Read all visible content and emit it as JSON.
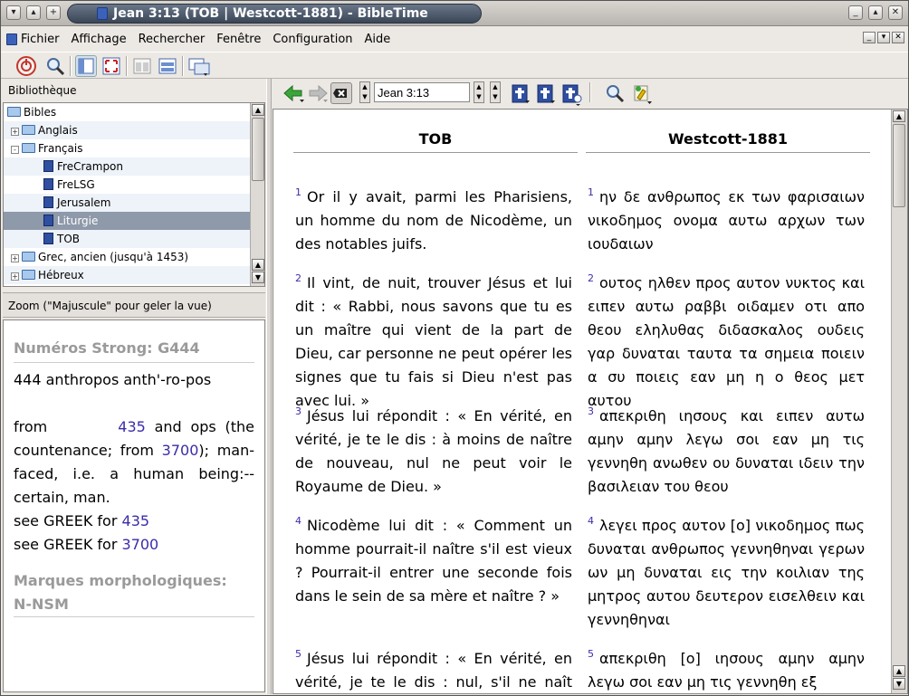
{
  "window": {
    "title": "Jean 3:13 (TOB | Westcott-1881) - BibleTime"
  },
  "menu": [
    "Fichier",
    "Affichage",
    "Rechercher",
    "Fenêtre",
    "Configuration",
    "Aide"
  ],
  "library": {
    "header": "Bibliothèque",
    "items": [
      {
        "label": "Bibles",
        "level": 0,
        "type": "folder",
        "expander": ""
      },
      {
        "label": "Anglais",
        "level": 1,
        "type": "folder",
        "expander": "+"
      },
      {
        "label": "Français",
        "level": 1,
        "type": "folder",
        "expander": "-"
      },
      {
        "label": "FreCrampon",
        "level": 2,
        "type": "book"
      },
      {
        "label": "FreLSG",
        "level": 2,
        "type": "book"
      },
      {
        "label": "Jerusalem",
        "level": 2,
        "type": "book"
      },
      {
        "label": "Liturgie",
        "level": 2,
        "type": "book",
        "selected": true
      },
      {
        "label": "TOB",
        "level": 2,
        "type": "book"
      },
      {
        "label": "Grec, ancien (jusqu'à 1453)",
        "level": 1,
        "type": "folder",
        "expander": "+"
      },
      {
        "label": "Hébreux",
        "level": 1,
        "type": "folder",
        "expander": "+"
      }
    ]
  },
  "zoom": {
    "header": "Zoom (\"Majuscule\" pour geler la vue)",
    "strong_heading": "Numéros Strong: G444",
    "entry": "444 anthropos anth'-ro-pos",
    "def1": "from",
    "link1": "435",
    "def2": "and ops (the countenance; from",
    "link2": "3700",
    "def3": "); man-faced, i.e. a human being:--certain, man.",
    "see1": "see GREEK for",
    "see1_link": "435",
    "see2": "see GREEK for",
    "see2_link": "3700",
    "morph_heading": "Marques morphologiques:",
    "morph_value": "N-NSM"
  },
  "reader": {
    "reference": "Jean 3:13",
    "columns": [
      {
        "title": "TOB",
        "verses": [
          {
            "n": "1",
            "text": "Or il y avait, parmi les Pharisiens, un homme du nom de Nicodème, un des notables juifs."
          },
          {
            "n": "2",
            "text": "Il vint, de nuit, trouver Jésus et lui dit : « Rabbi, nous savons que tu es un maître qui vient de la part de Dieu, car personne ne peut opérer les signes que tu fais si Dieu n'est pas avec lui. »"
          },
          {
            "n": "3",
            "text": "Jésus lui répondit : « En vérité, en vérité, je te le dis : à moins de naître de nouveau, nul ne peut voir le Royaume de Dieu. »"
          },
          {
            "n": "4",
            "text": "Nicodème lui dit : « Comment un homme pourrait-il naître s'il est vieux ? Pourrait-il entrer une seconde fois dans le sein de sa mère et naître ? »"
          },
          {
            "n": "5",
            "text": "Jésus lui répondit : « En vérité, en vérité, je te le dis : nul, s'il ne naît d'eau"
          }
        ]
      },
      {
        "title": "Westcott-1881",
        "verses": [
          {
            "n": "1",
            "text": "ην δε ανθρωπος εκ των φαρισαιων νικοδημος ονομα αυτω αρχων των ιουδαιων"
          },
          {
            "n": "2",
            "text": "ουτος ηλθεν προς αυτον νυκτος και ειπεν αυτω ραββι οιδαμεν οτι απο θεου εληλυθας διδασκαλος ουδεις γαρ δυναται ταυτα τα σημεια ποιειν α συ ποιεις εαν μη η ο θεος μετ αυτου"
          },
          {
            "n": "3",
            "text": "απεκριθη ιησους και ειπεν αυτω αμην αμην λεγω σοι εαν μη τις γεννηθη ανωθεν ου δυναται ιδειν την βασιλειαν του θεου"
          },
          {
            "n": "4",
            "text": "λεγει προς αυτον [ο] νικοδημος πως δυναται ανθρωπος γεννηθηναι γερων ων μη δυναται εις την κοιλιαν της μητρος αυτου δευτερον εισελθειν και γεννηθηναι"
          },
          {
            "n": "5",
            "text": "απεκριθη [ο] ιησους αμην αμην λεγω σοι εαν μη τις γεννηθη εξ"
          }
        ]
      }
    ]
  }
}
